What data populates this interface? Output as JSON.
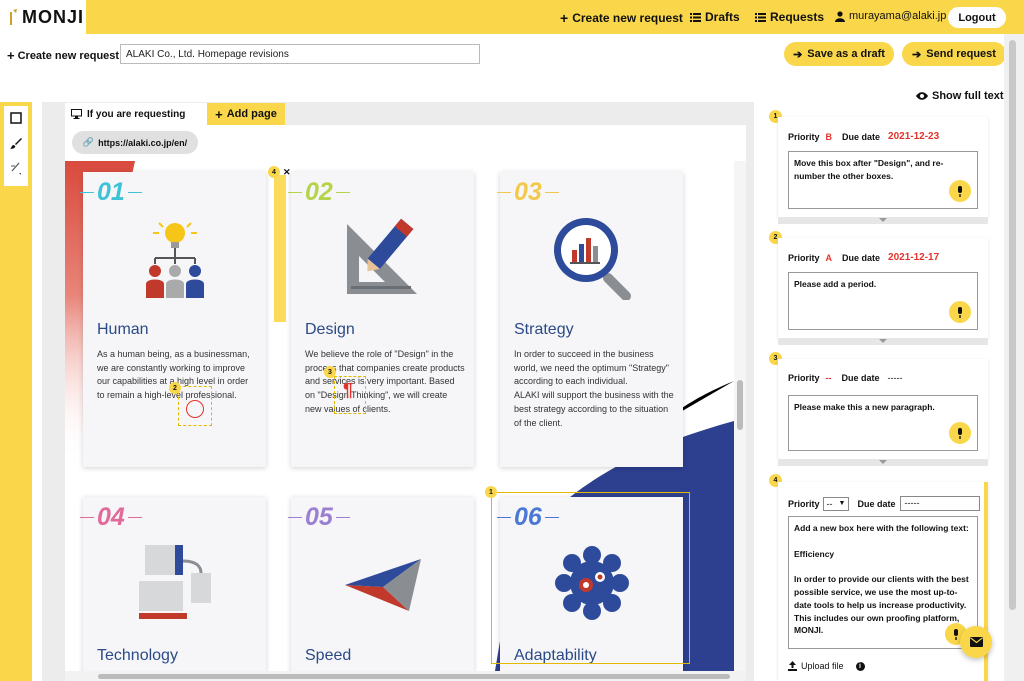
{
  "app": {
    "name": "MONJI"
  },
  "header": {
    "nav": {
      "create": "Create new request",
      "drafts": "Drafts",
      "requests": "Requests",
      "user": "murayama@alaki.jp"
    },
    "logout": "Logout"
  },
  "toolbar": {
    "breadcrumb": "Create new request",
    "title_value": "ALAKI Co., Ltd. Homepage revisions",
    "save_draft": "Save as a draft",
    "send": "Send request"
  },
  "tabs": {
    "requesting": "If you are requesting",
    "add_page": "Add page"
  },
  "url": "https://alaki.co.jp/en/",
  "cards": [
    {
      "num": "01",
      "title": "Human",
      "desc": "As a human being, as a businessman, we are constantly working to improve our capabilities at a high level in order to remain a high-level professional."
    },
    {
      "num": "02",
      "title": "Design",
      "desc": "We believe the role of \"Design\" in the process that companies create products and services is very important. Based on \"Design Thinking\", we will create new values of clients."
    },
    {
      "num": "03",
      "title": "Strategy",
      "desc": "In order to succeed in the business world, we need the optimum \"Strategy\" according to each individual.\nALAKI will support the business with the best strategy according to the situation of the client."
    },
    {
      "num": "04",
      "title": "Technology",
      "desc": ""
    },
    {
      "num": "05",
      "title": "Speed",
      "desc": ""
    },
    {
      "num": "06",
      "title": "Adaptability",
      "desc": ""
    }
  ],
  "markers": [
    "1",
    "2",
    "3",
    "4"
  ],
  "panel": {
    "show_full_text": "Show full text",
    "priority_label": "Priority",
    "due_label": "Due date",
    "requests": [
      {
        "num": "1",
        "priority": "B",
        "due": "2021-12-23",
        "text": "Move this box after \"Design\", and re-number the other boxes."
      },
      {
        "num": "2",
        "priority": "A",
        "due": "2021-12-17",
        "text": "Please add a period."
      },
      {
        "num": "3",
        "priority": "--",
        "due": "-----",
        "text": "Please make this a new paragraph."
      },
      {
        "num": "4",
        "priority": "--",
        "due": "-----",
        "text": "Add a new box here with the following text:\n\nEfficiency\n\nIn order to provide our clients with the best possible service, we use the most up-to-date tools to help us increase productivity. This includes our own proofing platform, MONJI."
      }
    ],
    "upload": "Upload file"
  },
  "colors": {
    "accent": "#fad74a",
    "due_red": "#e4332d",
    "title_blue": "#2b4a86"
  }
}
